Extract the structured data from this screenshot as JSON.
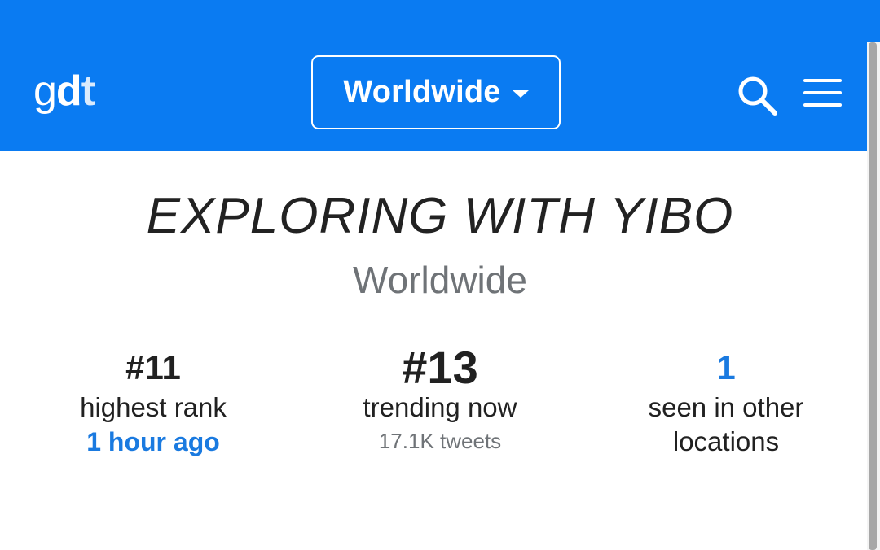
{
  "header": {
    "logo": {
      "part1": "g",
      "part2": "d",
      "part3": "t"
    },
    "location_selector": {
      "label": "Worldwide"
    },
    "icons": {
      "search": "search-icon",
      "menu": "hamburger-menu-icon"
    }
  },
  "trend": {
    "title": "EXPLORING WITH YIBO",
    "location": "Worldwide"
  },
  "stats": {
    "highest_rank": {
      "value": "#11",
      "label": "highest rank",
      "sub": "1 hour ago"
    },
    "trending_now": {
      "value": "#13",
      "label": "trending now",
      "sub": "17.1K tweets"
    },
    "other_locations": {
      "value": "1",
      "label_line1": "seen in other",
      "label_line2": "locations"
    }
  },
  "colors": {
    "header_bg": "#0a7bf2",
    "link_blue": "#1a7ae0",
    "text_dark": "#212121",
    "text_gray": "#6f7377"
  }
}
